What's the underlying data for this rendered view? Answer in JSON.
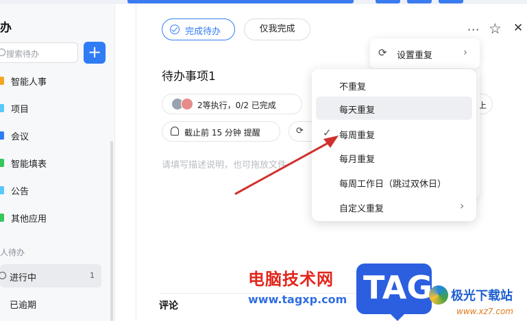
{
  "sidebar": {
    "title": "办",
    "search_placeholder": "搜索待办",
    "add_label": "+",
    "apps": [
      {
        "label": "智能人事",
        "color": "#f5a623"
      },
      {
        "label": "项目",
        "color": "#5ac8fa"
      },
      {
        "label": "会议",
        "color": "#2f7cf6"
      },
      {
        "label": "智能填表",
        "color": "#34c759"
      },
      {
        "label": "公告",
        "color": "#5ac8fa"
      },
      {
        "label": "其他应用",
        "color": "#34c759"
      }
    ],
    "section_title": "人待办",
    "statuses": [
      {
        "label": "进行中",
        "count": "1"
      },
      {
        "label": "已逾期",
        "count": ""
      }
    ]
  },
  "header": {
    "complete_label": "完成待办",
    "self_complete_label": "仅我完成",
    "more_icon": "···",
    "star_icon": "☆",
    "close_icon": "✕"
  },
  "task": {
    "title": "待办事项1",
    "assignee_chip": "2等执行，0/2 已完成",
    "reminder_chip": "截止前 15 分钟 提醒",
    "description_placeholder": "请填写描述说明，也可拖放文件",
    "comment_title": "评论"
  },
  "repeat_menu": {
    "parent_label": "设置重复",
    "options": [
      {
        "label": "不重复",
        "checked": false,
        "hover": false,
        "has_submenu": false
      },
      {
        "label": "每天重复",
        "checked": false,
        "hover": true,
        "has_submenu": false
      },
      {
        "label": "每周重复",
        "checked": true,
        "hover": false,
        "has_submenu": false
      },
      {
        "label": "每月重复",
        "checked": false,
        "hover": false,
        "has_submenu": false
      },
      {
        "label": "每周工作日（跳过双休日）",
        "checked": false,
        "hover": false,
        "has_submenu": false
      },
      {
        "label": "自定义重复",
        "checked": false,
        "hover": false,
        "has_submenu": true
      }
    ]
  },
  "partial_chip_text": "上",
  "watermarks": {
    "site_cn": "电脑技术网",
    "site_url": "www.tagxp.com",
    "tag": "TAG",
    "site2_cn": "极光下载站",
    "site2_url": "www.xz7.com"
  },
  "colors": {
    "accent": "#2f7cf6",
    "arrow": "#d0312d"
  }
}
